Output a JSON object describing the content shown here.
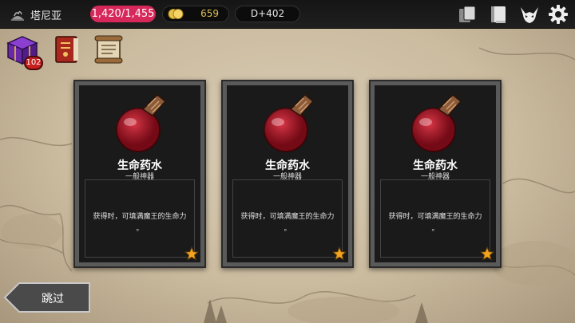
{
  "topbar": {
    "location_name": "塔尼亚",
    "hp": "1,420/1,455",
    "gold": "659",
    "day": "D+402"
  },
  "quick": {
    "chest_badge": "102"
  },
  "cards": [
    {
      "title": "生命药水",
      "subtitle": "一般神器",
      "desc_line1": "获得时，可填满魔王的生命力",
      "desc_line2": "。"
    },
    {
      "title": "生命药水",
      "subtitle": "一般神器",
      "desc_line1": "获得时，可填满魔王的生命力",
      "desc_line2": "。"
    },
    {
      "title": "生命药水",
      "subtitle": "一般神器",
      "desc_line1": "获得时，可填满魔王的生命力",
      "desc_line2": "。"
    }
  ],
  "skip_label": "跳过",
  "colors": {
    "hp_pill": "#d6285a",
    "gold_text": "#e0c050",
    "card_frame": "#5a5a5a",
    "card_inner": "#1a1a1a",
    "potion_red": "#b01828"
  },
  "icons": [
    "location-icon",
    "coin-icon",
    "cards-icon",
    "book-icon",
    "demon-lord-icon",
    "gear-icon",
    "chest-icon",
    "spellbook-icon",
    "scroll-icon",
    "potion-icon",
    "star-icon"
  ]
}
